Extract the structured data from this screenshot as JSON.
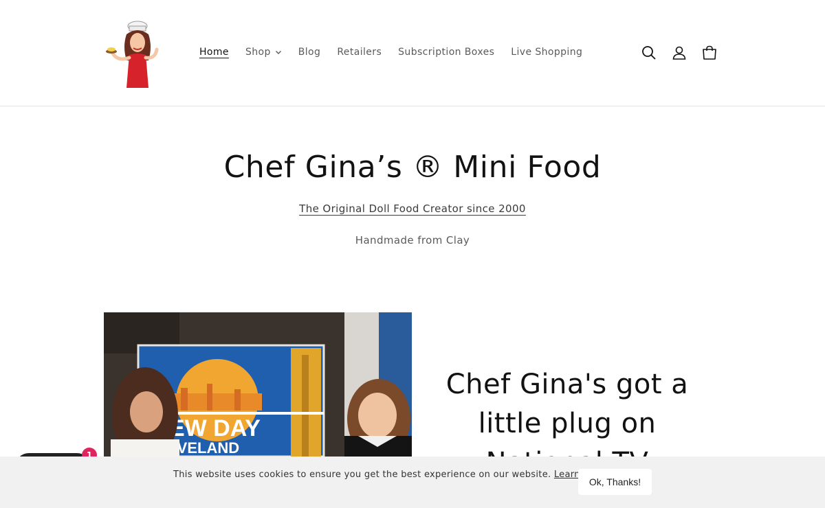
{
  "nav": {
    "items": [
      {
        "label": "Home",
        "active": true
      },
      {
        "label": "Shop",
        "has_dropdown": true
      },
      {
        "label": "Blog"
      },
      {
        "label": "Retailers"
      },
      {
        "label": "Subscription Boxes"
      },
      {
        "label": "Live Shopping"
      }
    ]
  },
  "header_icons": [
    "search-icon",
    "account-icon",
    "cart-icon"
  ],
  "hero": {
    "title": "Chef Gina’s ® Mini Food",
    "link": "The Original Doll Food Creator since 2000",
    "subtitle": "Handmade from Clay"
  },
  "video": {
    "banner_text_1": "EW DAY",
    "banner_text_2": "EVELAND"
  },
  "feature": {
    "heading": "Chef Gina's got a little plug on National TV"
  },
  "chat": {
    "badge_count": "1"
  },
  "cookie": {
    "message": "This website uses cookies to ensure you get the best experience on our website.",
    "learn_more": "Learn More",
    "button": "Ok, Thanks!"
  },
  "colors": {
    "text": "#121212",
    "muted": "#5a5a5a",
    "cookie_bg": "#f1f1f1",
    "badge": "#e0245e",
    "accent_red": "#d6232b"
  }
}
